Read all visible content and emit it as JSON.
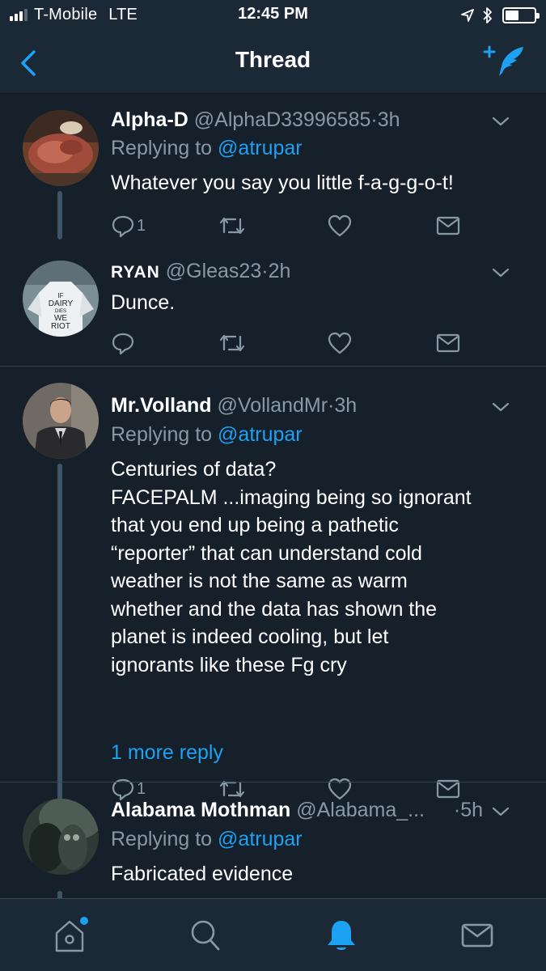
{
  "status_bar": {
    "carrier": "T-Mobile",
    "network": "LTE",
    "time": "12:45 PM"
  },
  "nav": {
    "title": "Thread",
    "back_icon": "chevron-left-icon",
    "compose_icon": "compose-tweet-icon"
  },
  "colors": {
    "background": "#15202b",
    "bar": "#1b2836",
    "accent": "#1da1f2",
    "muted": "#8899a6",
    "divider": "#38444d"
  },
  "tweets": [
    {
      "name": "Alpha-D",
      "handle": "@AlphaD33996585",
      "sep": "·",
      "time": "3h",
      "replying_prefix": "Replying to",
      "replying_to": "@atrupar",
      "text": "Whatever you say you little f-a-g-g-o-t!",
      "reply_count": "1"
    },
    {
      "name": "RYAN",
      "handle": "@Gleas23",
      "sep": "·",
      "time": "2h",
      "text": "Dunce.",
      "reply_count": ""
    },
    {
      "name": "Mr.Volland",
      "handle": "@VollandMr",
      "sep": "·",
      "time": "3h",
      "replying_prefix": "Replying to",
      "replying_to": "@atrupar",
      "text": "Centuries of data?\nFACEPALM ...imaging being so ignorant\nthat you end up being a pathetic\n“reporter” that can understand cold\nweather is not the same as warm\nwhether and the data has shown the\nplanet is indeed cooling, but let\nignorants like these Fg cry",
      "reply_count": "1",
      "more_replies": "1 more reply"
    },
    {
      "name": "Alabama Mothman",
      "handle": "@Alabama_...",
      "sep": "·",
      "time": "5h",
      "replying_prefix": "Replying to",
      "replying_to": "@atrupar",
      "text": "Fabricated evidence"
    }
  ],
  "tab_bar": {
    "tabs": [
      {
        "icon": "home-icon",
        "has_notification_dot": true
      },
      {
        "icon": "search-icon"
      },
      {
        "icon": "notifications-bell-icon",
        "active": true
      },
      {
        "icon": "messages-envelope-icon"
      }
    ]
  }
}
